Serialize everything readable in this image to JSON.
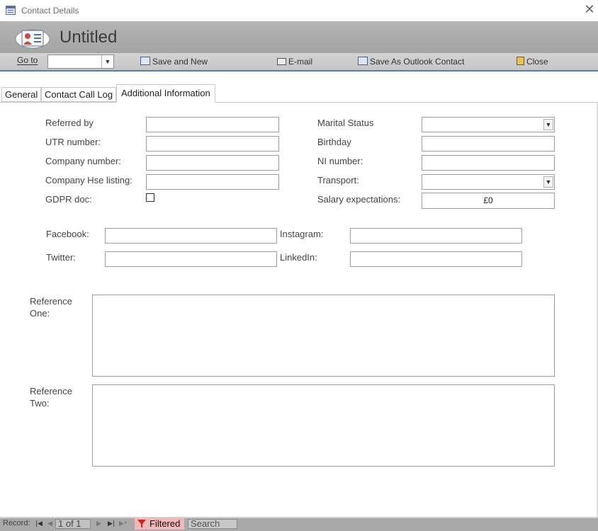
{
  "window": {
    "title": "Contact Details",
    "close_glyph": "✕"
  },
  "header": {
    "title": "Untitled",
    "icon": "contact-card-icon"
  },
  "toolbar": {
    "goto_label": "Go to",
    "goto_value": "",
    "save_new": "Save and New",
    "email": "E-mail",
    "save_outlook": "Save As Outlook Contact",
    "close": "Close"
  },
  "tabs": [
    {
      "label": "General"
    },
    {
      "label": "Contact Call Log"
    },
    {
      "label": "Additional Information",
      "selected": true
    }
  ],
  "form": {
    "left": {
      "referred_by": {
        "label": "Referred by",
        "value": ""
      },
      "utr": {
        "label": "UTR number:",
        "value": ""
      },
      "company_number": {
        "label": "Company number:",
        "value": ""
      },
      "company_hse": {
        "label": "Company Hse listing:",
        "value": ""
      },
      "gdpr": {
        "label": "GDPR doc:",
        "checked": false
      }
    },
    "right": {
      "marital": {
        "label": "Marital Status",
        "value": ""
      },
      "birthday": {
        "label": "Birthday",
        "value": ""
      },
      "ni": {
        "label": "NI number:",
        "value": ""
      },
      "transport": {
        "label": "Transport:",
        "value": ""
      },
      "salary": {
        "label": "Salary expectations:",
        "value": "£0"
      }
    },
    "social": {
      "facebook": {
        "label": "Facebook:",
        "value": ""
      },
      "instagram": {
        "label": "Instagram:",
        "value": ""
      },
      "twitter": {
        "label": "Twitter:",
        "value": ""
      },
      "linkedin": {
        "label": "LinkedIn:",
        "value": ""
      }
    },
    "reference_one": {
      "label_line1": "Reference",
      "label_line2": "One:",
      "value": ""
    },
    "reference_two": {
      "label_line1": "Reference",
      "label_line2": "Two:",
      "value": ""
    }
  },
  "statusbar": {
    "record_label": "Record:",
    "position": "1 of 1",
    "filter_label": "Filtered",
    "search_placeholder": "Search"
  },
  "colors": {
    "accent": "#5a7bb5",
    "filtered_bg": "#f0b8b8"
  }
}
